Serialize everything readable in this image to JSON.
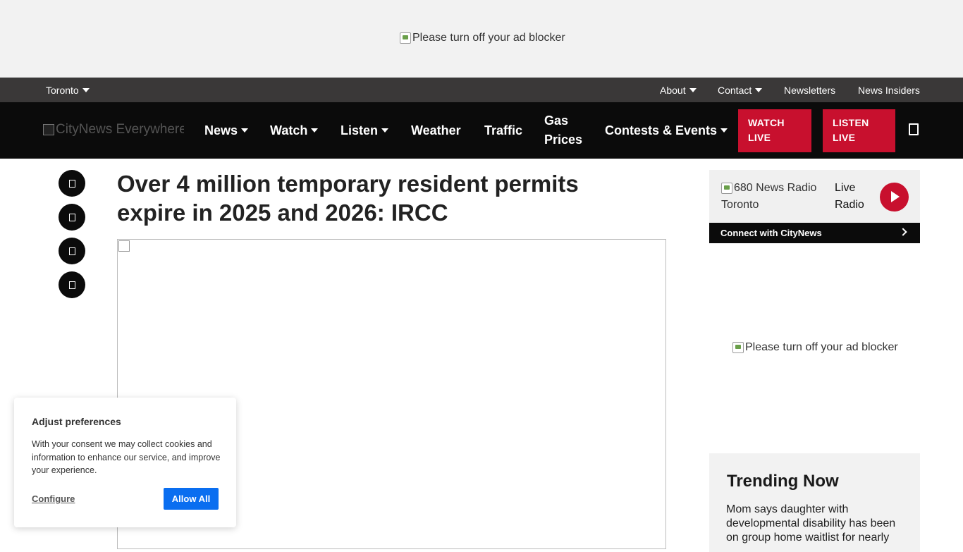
{
  "ads": {
    "top_alt": "Please turn off your ad blocker",
    "side_alt": "Please turn off your ad blocker"
  },
  "utility_bar": {
    "city": "Toronto",
    "about": "About",
    "contact": "Contact",
    "newsletters": "Newsletters",
    "news_insiders": "News Insiders"
  },
  "nav": {
    "logo_alt": "CityNews Everywhere",
    "items": [
      "News",
      "Watch",
      "Listen",
      "Weather",
      "Traffic",
      "Gas",
      "Prices",
      "Contests & Events"
    ],
    "watch_live": [
      "WATCH",
      "LIVE"
    ],
    "listen_live": [
      "LISTEN",
      "LIVE"
    ]
  },
  "article": {
    "headline_line1": "Over 4 million temporary resident permits",
    "headline_line2": "expire in 2025 and 2026: IRCC"
  },
  "sidebar": {
    "radio_alt_line1": "680 News Radio",
    "radio_alt_line2": "Toronto",
    "live_line1": "Live",
    "live_line2": "Radio",
    "connect": "Connect with CityNews",
    "trending_title": "Trending Now",
    "trending_item": "Mom says daughter with developmental disability has been on group home waitlist for nearly"
  },
  "cookie": {
    "title": "Adjust preferences",
    "text": "With your consent we may collect cookies and information to enhance our service, and improve your experience.",
    "configure": "Configure",
    "allow_all": "Allow All"
  },
  "colors": {
    "accent_red": "#c8102e",
    "nav_black": "#0b0b0b",
    "utility_gray": "#3a3838",
    "allow_blue": "#0a6ef0"
  }
}
